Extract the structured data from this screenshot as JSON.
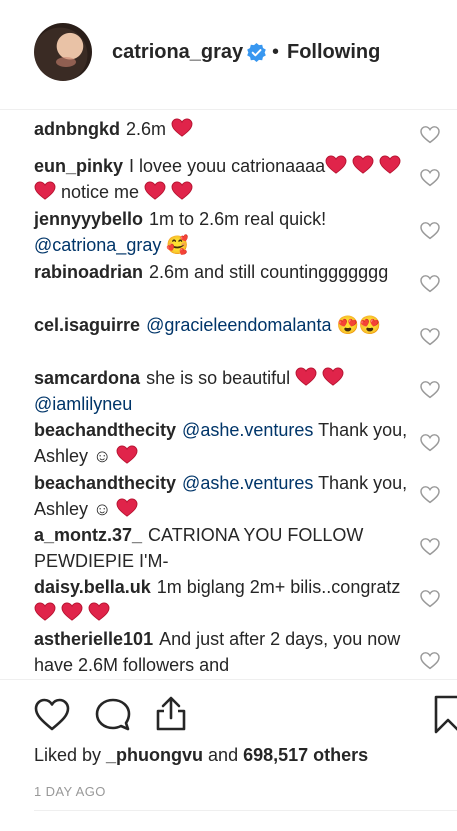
{
  "header": {
    "username": "catriona_gray",
    "separator": "•",
    "follow_status": "Following",
    "verified_color": "#3897f0"
  },
  "comments": [
    {
      "user": "adnbngkd",
      "parts": [
        {
          "t": "2.6m "
        },
        {
          "h": 1
        }
      ]
    },
    {
      "user": "eun_pinky",
      "parts": [
        {
          "t": "I lovee youu catrionaaaa"
        },
        {
          "h": 4
        },
        {
          "t": " notice me "
        },
        {
          "h": 2
        }
      ]
    },
    {
      "user": "jennyyybello",
      "parts": [
        {
          "t": "1m to 2.6m real quick! "
        },
        {
          "m": "@catriona_gray"
        },
        {
          "t": " 🥰"
        }
      ]
    },
    {
      "user": "rabinoadrian",
      "parts": [
        {
          "t": "2.6m and still countinggggggg"
        }
      ]
    },
    {
      "user": "cel.isaguirre",
      "parts": [
        {
          "m": "@gracieleendomalanta"
        },
        {
          "t": " 😍😍"
        }
      ]
    },
    {
      "user": "samcardona",
      "parts": [
        {
          "t": "she is so beautiful "
        },
        {
          "h": 2
        },
        {
          "t": " "
        },
        {
          "m": "@iamlilyneu"
        }
      ]
    },
    {
      "user": "beachandthecity",
      "parts": [
        {
          "m": "@ashe.ventures"
        },
        {
          "t": " Thank you, Ashley ☺ "
        },
        {
          "h": 1
        }
      ]
    },
    {
      "user": "beachandthecity",
      "parts": [
        {
          "m": "@ashe.ventures"
        },
        {
          "t": " Thank you, Ashley ☺ "
        },
        {
          "h": 1
        }
      ]
    },
    {
      "user": "a_montz.37_",
      "parts": [
        {
          "t": "CATRIONA YOU FOLLOW PEWDIEPIE I'M-"
        }
      ]
    },
    {
      "user": "daisy.bella.uk",
      "parts": [
        {
          "t": "1m biglang 2m+ bilis..congratz "
        },
        {
          "h": 3
        }
      ]
    },
    {
      "user": "astherielle101",
      "parts": [
        {
          "t": "And just after 2 days, you now have 2.6M followers and"
        }
      ]
    }
  ],
  "likes": {
    "prefix": "Liked by ",
    "first_user": "_phuongvu",
    "middle": " and ",
    "count": "698,517 others"
  },
  "date": "1 DAY AGO"
}
